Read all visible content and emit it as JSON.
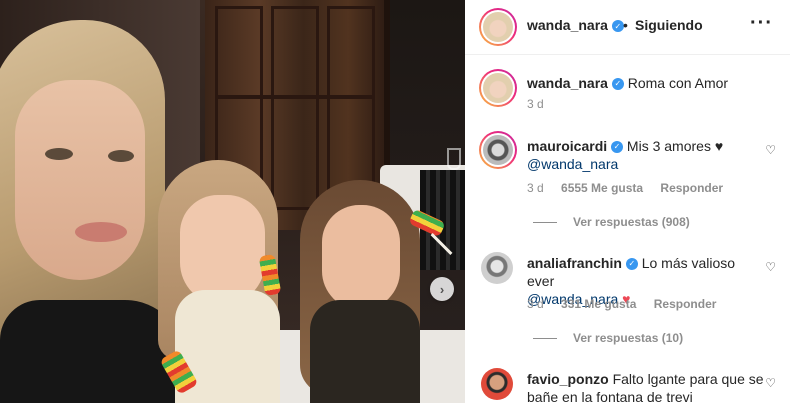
{
  "post": {
    "photo_alt": "",
    "next_arrow": "›"
  },
  "header": {
    "username": "wanda_nara",
    "separator": "•",
    "follow_state": "Siguiendo",
    "more": "···"
  },
  "caption": {
    "username": "wanda_nara",
    "text": "Roma con Amor",
    "time": "3 d"
  },
  "comments": [
    {
      "username": "mauroicardi",
      "text": "Mis 3 amores ♥",
      "mention": "@wanda_nara",
      "time": "3 d",
      "likes": "6555 Me gusta",
      "reply": "Responder",
      "view_replies": "Ver respuestas (908)"
    },
    {
      "username": "analiafranchin",
      "text": "Lo más valioso ever",
      "mention": "@wanda_nara",
      "emoji": "♥",
      "time": "3 d",
      "likes": "331 Me gusta",
      "reply": "Responder",
      "view_replies": "Ver respuestas (10)"
    },
    {
      "username": "favio_ponzo",
      "text": "Falto lgante para que se bañe en la fontana de trevi"
    }
  ],
  "icons": {
    "verified": "✓",
    "like_outline": "♡"
  },
  "colors": {
    "verified_blue": "#3897f0",
    "mention_blue": "#00376b",
    "meta_gray": "#8e8e8e",
    "like_red": "#ed4956"
  }
}
